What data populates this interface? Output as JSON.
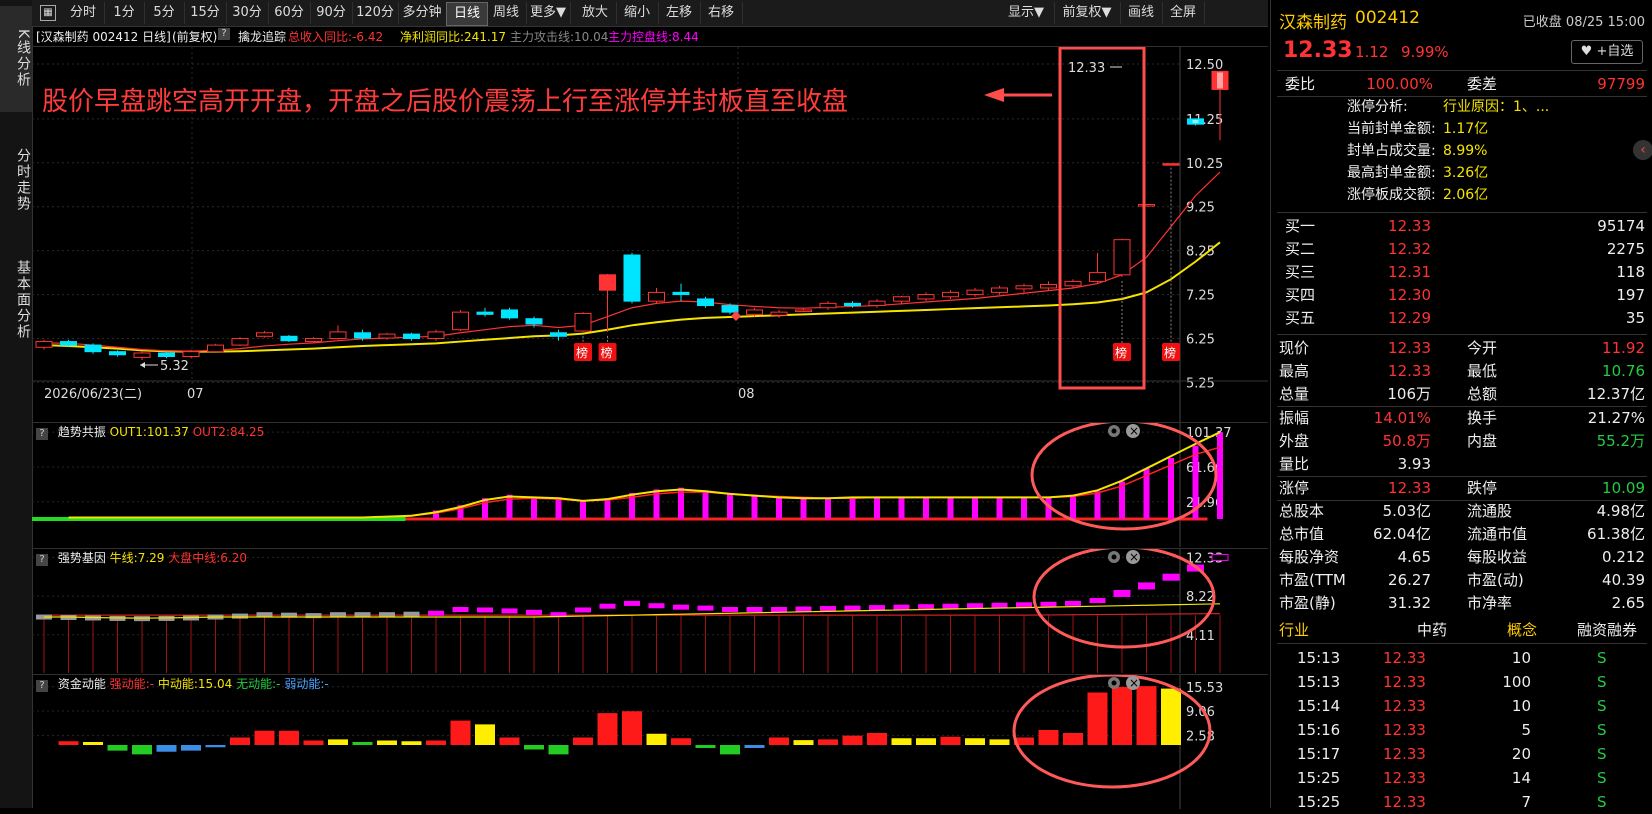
{
  "left_rail": {
    "tabs": [
      {
        "label": "K线分析",
        "active": true
      },
      {
        "label": "分时走势",
        "active": false
      },
      {
        "label": "基本面分析",
        "active": false
      }
    ]
  },
  "toolbar": {
    "buttons": [
      "分时",
      "1分",
      "5分",
      "15分",
      "30分",
      "60分",
      "90分",
      "120分",
      "多分钟",
      "日线",
      "周线",
      "更多▼",
      "放大",
      "缩小",
      "左移",
      "右移"
    ],
    "active": "日线",
    "right_buttons": [
      "显示▼",
      "前复权▼",
      "画线",
      "全屏"
    ]
  },
  "chart_header": {
    "stock": "[汉森制药 002412 日线]",
    "adjust": "(前复权)",
    "indicator_name": "擒龙追踪",
    "revenue_yoy": "总收入同比:-6.42",
    "profit_yoy": "净利润同比:241.17",
    "attack_line": "主力攻击线:10.04",
    "control_line": "主力控盘线:8.44"
  },
  "main_chart": {
    "annotation": "股价早盘跳空高开开盘，开盘之后股价震荡上行至涨停并封板直至收盘",
    "y_ticks": [
      "12.50",
      "11.25",
      "10.25",
      "9.25",
      "8.25",
      "7.25",
      "6.25",
      "5.25"
    ],
    "date_labels": [
      "2026/06/23(二)",
      "07",
      "08"
    ],
    "low_marker": "5.32",
    "high_marker": "12.33",
    "badge_label": "榜"
  },
  "chart_data": {
    "type": "candlestick",
    "candles": [
      {
        "o": 6.05,
        "c": 6.18,
        "h": 6.22,
        "l": 6.0
      },
      {
        "o": 6.18,
        "c": 6.1,
        "h": 6.22,
        "l": 6.05
      },
      {
        "o": 6.1,
        "c": 5.95,
        "h": 6.14,
        "l": 5.9
      },
      {
        "o": 5.95,
        "c": 5.88,
        "h": 5.98,
        "l": 5.84
      },
      {
        "o": 5.82,
        "c": 5.92,
        "h": 5.96,
        "l": 5.76
      },
      {
        "o": 5.92,
        "c": 5.84,
        "h": 5.95,
        "l": 5.8
      },
      {
        "o": 5.84,
        "c": 5.95,
        "h": 5.99,
        "l": 5.8
      },
      {
        "o": 5.95,
        "c": 6.1,
        "h": 6.13,
        "l": 5.92
      },
      {
        "o": 6.1,
        "c": 6.25,
        "h": 6.28,
        "l": 6.08
      },
      {
        "o": 6.3,
        "c": 6.38,
        "h": 6.42,
        "l": 6.27
      },
      {
        "o": 6.3,
        "c": 6.2,
        "h": 6.33,
        "l": 6.17
      },
      {
        "o": 6.18,
        "c": 6.25,
        "h": 6.28,
        "l": 6.14
      },
      {
        "o": 6.25,
        "c": 6.4,
        "h": 6.55,
        "l": 6.22
      },
      {
        "o": 6.38,
        "c": 6.26,
        "h": 6.45,
        "l": 6.2
      },
      {
        "o": 6.26,
        "c": 6.35,
        "h": 6.38,
        "l": 6.22
      },
      {
        "o": 6.35,
        "c": 6.25,
        "h": 6.38,
        "l": 6.2
      },
      {
        "o": 6.25,
        "c": 6.4,
        "h": 6.45,
        "l": 6.2
      },
      {
        "o": 6.45,
        "c": 6.85,
        "h": 6.9,
        "l": 6.42
      },
      {
        "o": 6.85,
        "c": 6.8,
        "h": 6.95,
        "l": 6.75
      },
      {
        "o": 6.9,
        "c": 6.72,
        "h": 6.95,
        "l": 6.68
      },
      {
        "o": 6.7,
        "c": 6.58,
        "h": 6.75,
        "l": 6.5
      },
      {
        "o": 6.38,
        "c": 6.3,
        "h": 6.45,
        "l": 6.2
      },
      {
        "o": 6.42,
        "c": 6.82,
        "h": 6.85,
        "l": 6.4
      },
      {
        "o": 7.35,
        "c": 7.7,
        "h": 7.72,
        "l": 6.4
      },
      {
        "o": 8.15,
        "c": 7.1,
        "h": 8.2,
        "l": 7.05
      },
      {
        "o": 7.1,
        "c": 7.3,
        "h": 7.4,
        "l": 7.05
      },
      {
        "o": 7.3,
        "c": 7.25,
        "h": 7.5,
        "l": 7.1
      },
      {
        "o": 7.15,
        "c": 7.0,
        "h": 7.2,
        "l": 6.95
      },
      {
        "o": 7.0,
        "c": 6.85,
        "h": 7.05,
        "l": 6.8
      },
      {
        "o": 6.8,
        "c": 6.9,
        "h": 6.95,
        "l": 6.75
      },
      {
        "o": 6.78,
        "c": 6.85,
        "h": 6.9,
        "l": 6.72
      },
      {
        "o": 6.9,
        "c": 6.9,
        "h": 6.95,
        "l": 6.85
      },
      {
        "o": 6.95,
        "c": 7.05,
        "h": 7.1,
        "l": 6.9
      },
      {
        "o": 7.05,
        "c": 7.0,
        "h": 7.1,
        "l": 6.95
      },
      {
        "o": 7.0,
        "c": 7.1,
        "h": 7.15,
        "l": 6.95
      },
      {
        "o": 7.1,
        "c": 7.2,
        "h": 7.22,
        "l": 7.02
      },
      {
        "o": 7.15,
        "c": 7.25,
        "h": 7.3,
        "l": 7.1
      },
      {
        "o": 7.2,
        "c": 7.3,
        "h": 7.35,
        "l": 7.15
      },
      {
        "o": 7.25,
        "c": 7.35,
        "h": 7.4,
        "l": 7.2
      },
      {
        "o": 7.3,
        "c": 7.4,
        "h": 7.45,
        "l": 7.25
      },
      {
        "o": 7.38,
        "c": 7.45,
        "h": 7.5,
        "l": 7.3
      },
      {
        "o": 7.4,
        "c": 7.48,
        "h": 7.55,
        "l": 7.35
      },
      {
        "o": 7.45,
        "c": 7.55,
        "h": 7.6,
        "l": 7.4
      },
      {
        "o": 7.55,
        "c": 7.75,
        "h": 8.2,
        "l": 7.5
      },
      {
        "o": 7.7,
        "c": 8.5,
        "h": 8.52,
        "l": 7.65
      },
      {
        "o": 9.3,
        "c": 9.3,
        "h": 9.3,
        "l": 9.3
      },
      {
        "o": 10.23,
        "c": 10.23,
        "h": 10.23,
        "l": 10.23
      },
      {
        "o": 11.25,
        "c": 11.13,
        "h": 11.25,
        "l": 11.1
      },
      {
        "o": 11.92,
        "c": 12.33,
        "h": 12.33,
        "l": 10.76
      }
    ],
    "ma_attack": [
      6.15,
      6.14,
      6.1,
      6.05,
      6.0,
      5.97,
      5.96,
      5.98,
      6.02,
      6.08,
      6.12,
      6.15,
      6.2,
      6.24,
      6.26,
      6.28,
      6.3,
      6.38,
      6.45,
      6.52,
      6.55,
      6.5,
      6.55,
      6.75,
      6.95,
      7.05,
      7.1,
      7.08,
      7.02,
      6.98,
      6.95,
      6.94,
      6.96,
      6.98,
      7.0,
      7.04,
      7.08,
      7.12,
      7.16,
      7.22,
      7.28,
      7.34,
      7.4,
      7.5,
      7.7,
      8.1,
      8.8,
      9.5,
      10.04
    ],
    "ma_control": [
      6.1,
      6.08,
      6.05,
      6.02,
      5.98,
      5.96,
      5.95,
      5.95,
      5.96,
      5.98,
      6.0,
      6.02,
      6.05,
      6.08,
      6.1,
      6.12,
      6.14,
      6.18,
      6.22,
      6.26,
      6.3,
      6.32,
      6.36,
      6.45,
      6.55,
      6.62,
      6.68,
      6.72,
      6.74,
      6.76,
      6.78,
      6.8,
      6.82,
      6.84,
      6.86,
      6.88,
      6.9,
      6.92,
      6.94,
      6.96,
      6.98,
      7.0,
      7.03,
      7.07,
      7.15,
      7.3,
      7.6,
      8.0,
      8.44
    ],
    "badges_at": [
      22,
      23,
      44,
      46
    ]
  },
  "sub1": {
    "name": "趋势共振",
    "out1": "OUT1:101.37",
    "out2": "OUT2:84.25",
    "y_ticks": [
      "101.37",
      "61.66",
      "21.96"
    ],
    "values": [
      0,
      0,
      0,
      0,
      0,
      0,
      0,
      0,
      0,
      0,
      0,
      0,
      0,
      0,
      0,
      12,
      18,
      26,
      30,
      28,
      27,
      24,
      26,
      32,
      36,
      38,
      35,
      32,
      30,
      28,
      27,
      26,
      27,
      27,
      28,
      27,
      27,
      27,
      27,
      27,
      27,
      28,
      34,
      45,
      60,
      72,
      86,
      101.37
    ],
    "line1": [
      4,
      4,
      4,
      4,
      4,
      4,
      4,
      4,
      4,
      4,
      4,
      4,
      4,
      5,
      6,
      10,
      16,
      24,
      28,
      27,
      26,
      23,
      25,
      30,
      34,
      36,
      34,
      31,
      29,
      27,
      26,
      26,
      27,
      27,
      27,
      27,
      27,
      27,
      27,
      27,
      27,
      29,
      35,
      46,
      60,
      74,
      88,
      101.37
    ],
    "line2": [
      4,
      4,
      4,
      4,
      4,
      4,
      4,
      4,
      4,
      4,
      4,
      4,
      4,
      5,
      6,
      9,
      14,
      21,
      25,
      26,
      25,
      23,
      24,
      27,
      31,
      33,
      33,
      31,
      29,
      28,
      27,
      26,
      26,
      27,
      27,
      27,
      27,
      27,
      27,
      27,
      27,
      28,
      32,
      40,
      52,
      64,
      76,
      84.25
    ]
  },
  "sub2": {
    "name": "强势基因",
    "bull": "牛线:7.29",
    "market": "大盘中线:6.20",
    "y_ticks": [
      "12.33",
      "8.22",
      "4.11"
    ],
    "values": [
      6.05,
      6.0,
      5.95,
      5.9,
      5.88,
      5.9,
      5.95,
      6.05,
      6.15,
      6.3,
      6.25,
      6.2,
      6.3,
      6.3,
      6.3,
      6.35,
      6.45,
      6.85,
      6.8,
      6.7,
      6.55,
      6.3,
      6.8,
      7.2,
      7.5,
      7.25,
      7.1,
      7.0,
      6.85,
      6.85,
      6.85,
      6.9,
      6.95,
      7.0,
      7.05,
      7.1,
      7.15,
      7.2,
      7.25,
      7.3,
      7.35,
      7.4,
      7.5,
      7.8,
      8.5,
      9.3,
      10.23,
      11.2,
      12.33
    ]
  },
  "sub3": {
    "name": "资金动能",
    "strong": "强动能:-",
    "mid": "中动能:15.04",
    "none": "无动能:-",
    "weak": "弱动能:-",
    "y_ticks": [
      "15.53",
      "9.06",
      "2.58"
    ],
    "bars": [
      {
        "v": 1.0,
        "c": "#ff1a1a"
      },
      {
        "v": 0.8,
        "c": "#ffee00"
      },
      {
        "v": -1.5,
        "c": "#22cc22"
      },
      {
        "v": -2.5,
        "c": "#22cc22"
      },
      {
        "v": -1.8,
        "c": "#3a8ee6"
      },
      {
        "v": -1.5,
        "c": "#3a8ee6"
      },
      {
        "v": -0.6,
        "c": "#3a8ee6"
      },
      {
        "v": 2.0,
        "c": "#ff1a1a"
      },
      {
        "v": 3.8,
        "c": "#ff1a1a"
      },
      {
        "v": 3.8,
        "c": "#ff1a1a"
      },
      {
        "v": 1.2,
        "c": "#ff1a1a"
      },
      {
        "v": 1.5,
        "c": "#ffee00"
      },
      {
        "v": 0.8,
        "c": "#22cc22"
      },
      {
        "v": 1.2,
        "c": "#ffee00"
      },
      {
        "v": 1.0,
        "c": "#ffee00"
      },
      {
        "v": 1.2,
        "c": "#ff1a1a"
      },
      {
        "v": 6.5,
        "c": "#ff1a1a"
      },
      {
        "v": 5.5,
        "c": "#ffee00"
      },
      {
        "v": 2.0,
        "c": "#ff1a1a"
      },
      {
        "v": -1.2,
        "c": "#22cc22"
      },
      {
        "v": -2.5,
        "c": "#22cc22"
      },
      {
        "v": 2.0,
        "c": "#ff1a1a"
      },
      {
        "v": 8.5,
        "c": "#ff1a1a"
      },
      {
        "v": 9.0,
        "c": "#ff1a1a"
      },
      {
        "v": 3.0,
        "c": "#ffee00"
      },
      {
        "v": 1.8,
        "c": "#ff1a1a"
      },
      {
        "v": -0.8,
        "c": "#22cc22"
      },
      {
        "v": -2.5,
        "c": "#22cc22"
      },
      {
        "v": -0.8,
        "c": "#3a8ee6"
      },
      {
        "v": 2.0,
        "c": "#ff1a1a"
      },
      {
        "v": 1.3,
        "c": "#ffee00"
      },
      {
        "v": 1.5,
        "c": "#ff1a1a"
      },
      {
        "v": 2.5,
        "c": "#ff1a1a"
      },
      {
        "v": 3.2,
        "c": "#ff1a1a"
      },
      {
        "v": 1.8,
        "c": "#ffee00"
      },
      {
        "v": 1.8,
        "c": "#ffee00"
      },
      {
        "v": 2.2,
        "c": "#ff1a1a"
      },
      {
        "v": 1.8,
        "c": "#ffee00"
      },
      {
        "v": 1.5,
        "c": "#ffee00"
      },
      {
        "v": 2.0,
        "c": "#ff1a1a"
      },
      {
        "v": 4.0,
        "c": "#ff1a1a"
      },
      {
        "v": 3.2,
        "c": "#ff1a1a"
      },
      {
        "v": 14.0,
        "c": "#ff1a1a"
      },
      {
        "v": 15.5,
        "c": "#ff1a1a"
      },
      {
        "v": 15.7,
        "c": "#ff1a1a"
      },
      {
        "v": 15.04,
        "c": "#ffee00"
      }
    ]
  },
  "right_panel": {
    "name": "汉森制药",
    "code": "002412",
    "status": "已收盘 08/25 15:00",
    "price": "12.33",
    "change": "1.12",
    "change_pct": "9.99%",
    "watch_button": "+自选",
    "ratio_label": "委比",
    "ratio_value": "100.00%",
    "diff_label": "委差",
    "diff_value": "97799",
    "limit_analysis": [
      {
        "label": "涨停分析:",
        "value": "行业原因：1、..."
      },
      {
        "label": "当前封单金额:",
        "value": "1.17亿"
      },
      {
        "label": "封单占成交量:",
        "value": "8.99%"
      },
      {
        "label": "最高封单金额:",
        "value": "3.26亿"
      },
      {
        "label": "涨停板成交额:",
        "value": "2.06亿"
      }
    ],
    "bids": [
      {
        "label": "买一",
        "price": "12.33",
        "vol": "95174"
      },
      {
        "label": "买二",
        "price": "12.32",
        "vol": "2275"
      },
      {
        "label": "买三",
        "price": "12.31",
        "vol": "118"
      },
      {
        "label": "买四",
        "price": "12.30",
        "vol": "197"
      },
      {
        "label": "买五",
        "price": "12.29",
        "vol": "35"
      }
    ],
    "stats": [
      {
        "l1": "现价",
        "v1": "12.33",
        "c1": "red",
        "l2": "今开",
        "v2": "11.92",
        "c2": "red"
      },
      {
        "l1": "最高",
        "v1": "12.33",
        "c1": "red",
        "l2": "最低",
        "v2": "10.76",
        "c2": "green"
      },
      {
        "l1": "总量",
        "v1": "106万",
        "c1": "white",
        "l2": "总额",
        "v2": "12.37亿",
        "c2": "white"
      },
      {
        "l1": "振幅",
        "v1": "14.01%",
        "c1": "red",
        "l2": "换手",
        "v2": "21.27%",
        "c2": "white"
      },
      {
        "l1": "外盘",
        "v1": "50.8万",
        "c1": "red",
        "l2": "内盘",
        "v2": "55.2万",
        "c2": "green"
      },
      {
        "l1": "量比",
        "v1": "3.93",
        "c1": "white",
        "l2": "",
        "v2": "",
        "c2": "white"
      },
      {
        "l1": "涨停",
        "v1": "12.33",
        "c1": "red",
        "l2": "跌停",
        "v2": "10.09",
        "c2": "green"
      },
      {
        "l1": "总股本",
        "v1": "5.03亿",
        "c1": "white",
        "l2": "流通股",
        "v2": "4.98亿",
        "c2": "white"
      },
      {
        "l1": "总市值",
        "v1": "62.04亿",
        "c1": "white",
        "l2": "流通市值",
        "v2": "61.38亿",
        "c2": "white"
      },
      {
        "l1": "每股净资",
        "v1": "4.65",
        "c1": "white",
        "l2": "每股收益",
        "v2": "0.212",
        "c2": "white"
      },
      {
        "l1": "市盈(TTM",
        "v1": "26.27",
        "c1": "white",
        "l2": "市盈(动)",
        "v2": "40.39",
        "c2": "white"
      },
      {
        "l1": "市盈(静)",
        "v1": "31.32",
        "c1": "white",
        "l2": "市净率",
        "v2": "2.65",
        "c2": "white"
      }
    ],
    "industry_label": "行业",
    "industry_value": "中药",
    "concept_label": "概念",
    "margin_label": "融资融券",
    "trades": [
      {
        "t": "15:13",
        "p": "12.33",
        "v": "10",
        "s": "S"
      },
      {
        "t": "15:13",
        "p": "12.33",
        "v": "100",
        "s": "S"
      },
      {
        "t": "15:14",
        "p": "12.33",
        "v": "10",
        "s": "S"
      },
      {
        "t": "15:16",
        "p": "12.33",
        "v": "5",
        "s": "S"
      },
      {
        "t": "15:17",
        "p": "12.33",
        "v": "20",
        "s": "S"
      },
      {
        "t": "15:25",
        "p": "12.33",
        "v": "14",
        "s": "S"
      },
      {
        "t": "15:25",
        "p": "12.33",
        "v": "7",
        "s": "S"
      }
    ]
  }
}
